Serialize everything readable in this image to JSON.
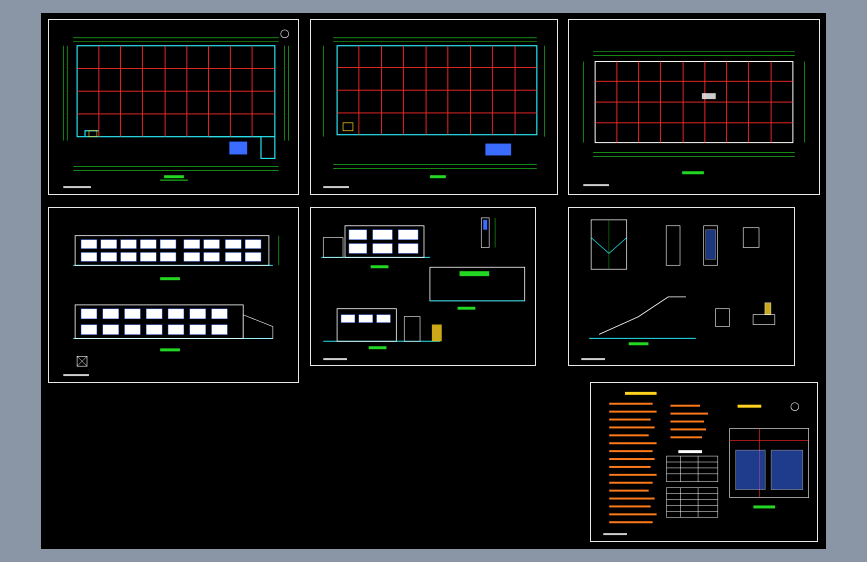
{
  "viewer": {
    "background_color": "#8a96a6",
    "canvas_color": "#000000"
  },
  "colors": {
    "sheet_border": "#e8e8e8",
    "grid_red": "#ff2a2a",
    "wall_cyan": "#27e3f0",
    "dimension_green": "#22d822",
    "annotation_yellow": "#ffd21f",
    "text_white": "#ffffff",
    "glass_blue": "#3a6cff",
    "note_orange": "#ff7a1a"
  },
  "sheets": [
    {
      "id": "floor-plan-1",
      "type": "floor-plan"
    },
    {
      "id": "floor-plan-2",
      "type": "floor-plan"
    },
    {
      "id": "roof-plan",
      "type": "roof-plan"
    },
    {
      "id": "elevations",
      "type": "elevation"
    },
    {
      "id": "sections",
      "type": "section"
    },
    {
      "id": "stair-details",
      "type": "detail"
    },
    {
      "id": "notes-and-schedules",
      "type": "notes"
    }
  ],
  "icons": [
    "north-arrow-icon"
  ]
}
